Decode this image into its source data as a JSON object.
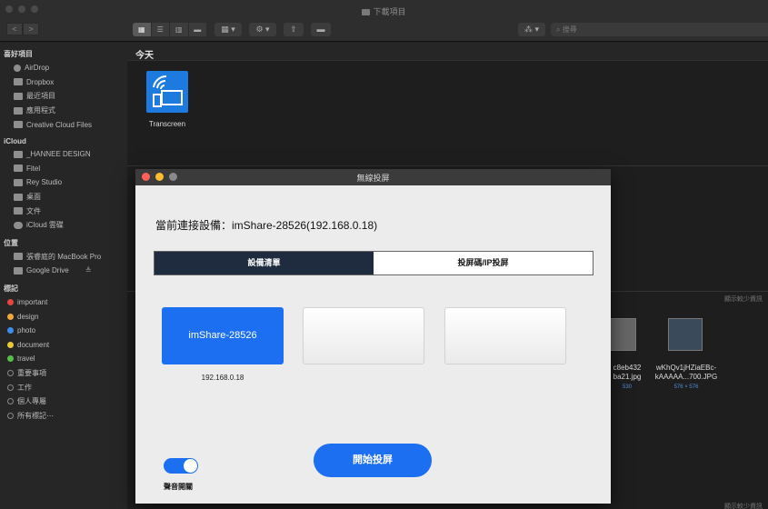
{
  "window": {
    "title": "下載項目",
    "nav_back": "<",
    "nav_forward": ">",
    "search_placeholder": "搜尋"
  },
  "sidebar": {
    "favorites_header": "喜好項目",
    "favorites": [
      {
        "label": "AirDrop",
        "icon": "airdrop-icon"
      },
      {
        "label": "Dropbox",
        "icon": "dropbox-icon"
      },
      {
        "label": "最近項目",
        "icon": "recents-icon"
      },
      {
        "label": "應用程式",
        "icon": "applications-icon"
      },
      {
        "label": "Creative Cloud Files",
        "icon": "folder-icon"
      }
    ],
    "icloud_header": "iCloud",
    "icloud": [
      {
        "label": "_HANNEE DESIGN",
        "icon": "folder-icon"
      },
      {
        "label": "Fitel",
        "icon": "folder-icon"
      },
      {
        "label": "Rey Studio",
        "icon": "folder-icon"
      },
      {
        "label": "桌面",
        "icon": "desktop-icon"
      },
      {
        "label": "文件",
        "icon": "documents-icon"
      },
      {
        "label": "iCloud 雲碟",
        "icon": "icloud-icon"
      }
    ],
    "locations_header": "位置",
    "locations": [
      {
        "label": "張睿庭的 MacBook Pro",
        "icon": "laptop-icon"
      },
      {
        "label": "Google Drive",
        "icon": "drive-icon"
      }
    ],
    "tags_header": "標記",
    "tags": [
      {
        "label": "important",
        "color": "#e4453f"
      },
      {
        "label": "design",
        "color": "#f2a83b"
      },
      {
        "label": "photo",
        "color": "#3d8cf0"
      },
      {
        "label": "document",
        "color": "#e8c93a"
      },
      {
        "label": "travel",
        "color": "#58c04a"
      },
      {
        "label": "重要事項",
        "color": ""
      },
      {
        "label": "工作",
        "color": ""
      },
      {
        "label": "個人專屬",
        "color": ""
      },
      {
        "label": "所有標記⋯",
        "color": ""
      }
    ]
  },
  "content": {
    "section_today": "今天",
    "app_name": "Transcreen",
    "hint_right": "顯示較少資訊",
    "hint_bottom": "顯示較少資訊",
    "files": [
      {
        "name_line1": "c8eb432",
        "name_line2": "ba21.jpg",
        "dims": "530"
      },
      {
        "name_line1": "wKhQv1jHZiaEBc-",
        "name_line2": "kAAAAA...700.JPG",
        "dims": "576 × 576"
      }
    ]
  },
  "dialog": {
    "title": "無線投屏",
    "connection_text": "當前連接設備：imShare-28526(192.168.0.18)",
    "tab_devices": "設備清單",
    "tab_code": "投屏碼/IP投屏",
    "selected_device": "imShare-28526",
    "selected_device_ip": "192.168.0.18",
    "sound_label": "聲音開關",
    "sound_on": true,
    "start_button": "開始投屏",
    "colors": {
      "accent": "#1b6ff0",
      "tab_active": "#1f2c3f",
      "close": "#fe5f57",
      "minimize": "#febc2e",
      "zoom": "#8a8a8a"
    }
  }
}
